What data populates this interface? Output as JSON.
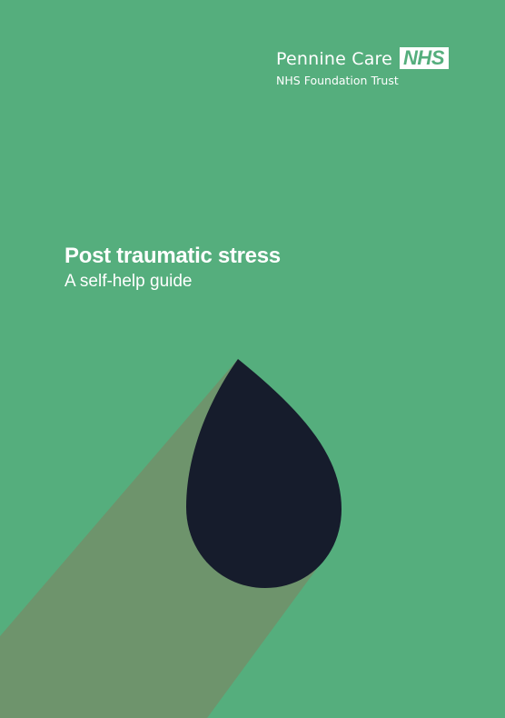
{
  "header": {
    "organisation": "Pennine Care",
    "logo_text": "NHS",
    "trust_line": "NHS Foundation Trust"
  },
  "cover": {
    "title": "Post traumatic stress",
    "subtitle": "A self-help guide"
  },
  "colors": {
    "background": "#55ae7d",
    "shadow": "#6e946c",
    "drop": "#161c2c",
    "text": "#ffffff"
  },
  "illustration": {
    "icon": "water-drop-icon"
  }
}
